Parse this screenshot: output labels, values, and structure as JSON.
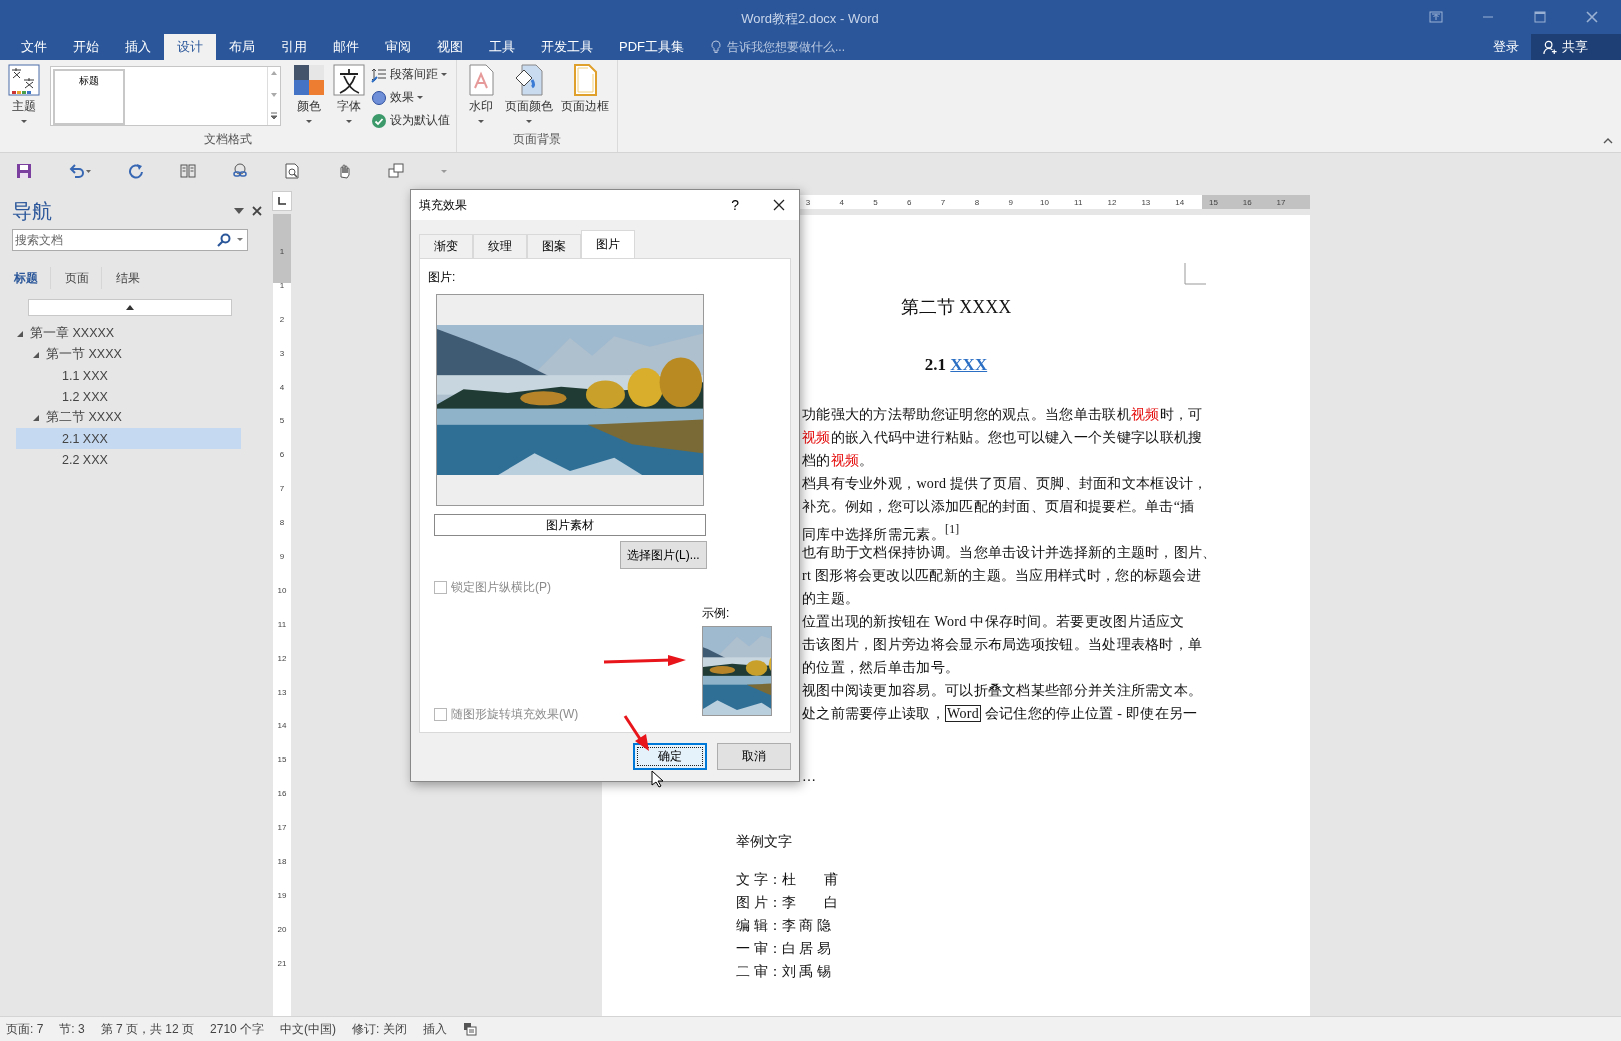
{
  "window": {
    "title": "Word教程2.docx - Word"
  },
  "ribbon_tabs": [
    {
      "label": "文件",
      "selected": false
    },
    {
      "label": "开始",
      "selected": false
    },
    {
      "label": "插入",
      "selected": false
    },
    {
      "label": "设计",
      "selected": true
    },
    {
      "label": "布局",
      "selected": false
    },
    {
      "label": "引用",
      "selected": false
    },
    {
      "label": "邮件",
      "selected": false
    },
    {
      "label": "审阅",
      "selected": false
    },
    {
      "label": "视图",
      "selected": false
    },
    {
      "label": "工具",
      "selected": false
    },
    {
      "label": "开发工具",
      "selected": false
    },
    {
      "label": "PDF工具集",
      "selected": false
    }
  ],
  "tell_me": {
    "placeholder": "告诉我您想要做什么..."
  },
  "account": {
    "sign_in": "登录",
    "share": "共享"
  },
  "ribbon": {
    "groups": [
      {
        "label": "文档格式",
        "items": [
          {
            "label": "主题",
            "kind": "large",
            "dropdown": true
          },
          {
            "kind": "gallery",
            "caption": "标题"
          },
          {
            "label": "颜色",
            "kind": "large",
            "dropdown": true
          },
          {
            "label": "字体",
            "kind": "large",
            "dropdown": true
          },
          {
            "label": "段落间距",
            "kind": "small",
            "dropdown": true
          },
          {
            "label": "效果",
            "kind": "small",
            "dropdown": true
          },
          {
            "label": "设为默认值",
            "kind": "small",
            "dropdown": false
          }
        ]
      },
      {
        "label": "页面背景",
        "items": [
          {
            "label": "水印",
            "kind": "large",
            "dropdown": true
          },
          {
            "label": "页面颜色",
            "kind": "large",
            "dropdown": true
          },
          {
            "label": "页面边框",
            "kind": "large",
            "dropdown": false
          }
        ]
      }
    ]
  },
  "nav": {
    "title": "导航",
    "search": {
      "placeholder": "搜索文档"
    },
    "tabs": [
      {
        "label": "标题",
        "selected": true
      },
      {
        "label": "页面",
        "selected": false
      },
      {
        "label": "结果",
        "selected": false
      }
    ],
    "tree": [
      {
        "label": "第一章 XXXXX",
        "expanded": true,
        "selected": false,
        "children": [
          {
            "label": "第一节 XXXX",
            "expanded": true,
            "selected": false,
            "children": [
              {
                "label": "1.1 XXX",
                "selected": false
              },
              {
                "label": "1.2 XXX",
                "selected": false
              }
            ]
          },
          {
            "label": "第二节 XXXX",
            "expanded": true,
            "selected": false,
            "children": [
              {
                "label": "2.1 XXX",
                "selected": true
              },
              {
                "label": "2.2 XXX",
                "selected": false
              }
            ]
          }
        ]
      }
    ]
  },
  "horizontal_ruler": [
    "3",
    "4",
    "5",
    "6",
    "7",
    "8",
    "9",
    "10",
    "11",
    "12",
    "13",
    "14",
    "15",
    "16",
    "17"
  ],
  "vertical_ruler": [
    "1",
    "1",
    "2",
    "3",
    "4",
    "5",
    "6",
    "7",
    "8",
    "9",
    "10",
    "11",
    "12",
    "13",
    "14",
    "15",
    "16",
    "17",
    "18",
    "19",
    "20",
    "21"
  ],
  "document": {
    "heading": "第二节 XXXX",
    "subheading": {
      "number": "2.1",
      "title": "XXX"
    },
    "lines": [
      [
        {
          "text": "功能强大的方法帮助您证明您的观点。当您单击联机",
          "kind": "plain"
        },
        {
          "text": "视频",
          "kind": "red"
        },
        {
          "text": "时，可",
          "kind": "plain"
        }
      ],
      [
        {
          "text": "视频",
          "kind": "red"
        },
        {
          "text": "的嵌入代码中进行粘贴。您也可以键入一个关键字以联机搜",
          "kind": "plain"
        }
      ],
      [
        {
          "text": "档的",
          "kind": "plain"
        },
        {
          "text": "视频",
          "kind": "red"
        },
        {
          "text": "。",
          "kind": "plain"
        }
      ],
      [
        {
          "text": "档具有专业外观，word 提供了页眉、页脚、封面和文本框设计，",
          "kind": "plain"
        }
      ],
      [
        {
          "text": "补充。例如，您可以添加匹配的封面、页眉和提要栏。单击“插",
          "kind": "plain"
        }
      ],
      [
        {
          "text": "同库中选择所需元素。$^{[1]}$",
          "kind": "plain"
        }
      ],
      [
        {
          "text": "也有助于文档保持协调。当您单击设计并选择新的主题时，图片、",
          "kind": "plain"
        }
      ],
      [
        {
          "text": "rt 图形将会更改以匹配新的主题。当应用样式时，您的标题会进",
          "kind": "plain"
        }
      ],
      [
        {
          "text": "的主题。",
          "kind": "plain"
        }
      ],
      [
        {
          "text": "位置出现的新按钮在 Word 中保存时间。若要更改图片适应文",
          "kind": "plain"
        }
      ],
      [
        {
          "text": "击该图片，图片旁边将会显示布局选项按钮。当处理表格时，单",
          "kind": "plain"
        }
      ],
      [
        {
          "text": "的位置，然后单击加号。",
          "kind": "plain"
        }
      ],
      [
        {
          "text": "视图中阅读更加容易。可以折叠文档某些部分并关注所需文本。",
          "kind": "plain"
        }
      ],
      [
        {
          "text": "处之前需要停止读取，",
          "kind": "plain"
        },
        {
          "text": "Word",
          "kind": "boxed"
        },
        {
          "text": " 会记住您的停止位置 - 即使在另一",
          "kind": "plain"
        }
      ]
    ],
    "ellipsis": "…",
    "example_title": "举例文字",
    "credits": [
      "文 字：杜　　甫",
      "图 片：李　　白",
      "编 辑：李 商 隐",
      "一 审：白 居 易",
      "二 审：刘 禹 锡"
    ]
  },
  "dialog": {
    "title": "填充效果",
    "help": "?",
    "tabs": [
      {
        "label": "渐变",
        "selected": false
      },
      {
        "label": "纹理",
        "selected": false
      },
      {
        "label": "图案",
        "selected": false
      },
      {
        "label": "图片",
        "selected": true
      }
    ],
    "picture_label": "图片:",
    "picture_name": "图片素材",
    "select_button": "选择图片(L)...",
    "options": [
      {
        "label": "锁定图片纵横比(P)",
        "checked": false,
        "disabled": true
      },
      {
        "label": "随图形旋转填充效果(W)",
        "checked": false,
        "disabled": true
      }
    ],
    "sample_label": "示例:",
    "buttons": [
      {
        "label": "确定",
        "default": true
      },
      {
        "label": "取消",
        "default": false
      }
    ]
  },
  "status_bar": [
    "页面: 7",
    "节: 3",
    "第 7 页，共 12 页",
    "2710 个字",
    "中文(中国)",
    "修订: 关闭",
    "插入"
  ]
}
